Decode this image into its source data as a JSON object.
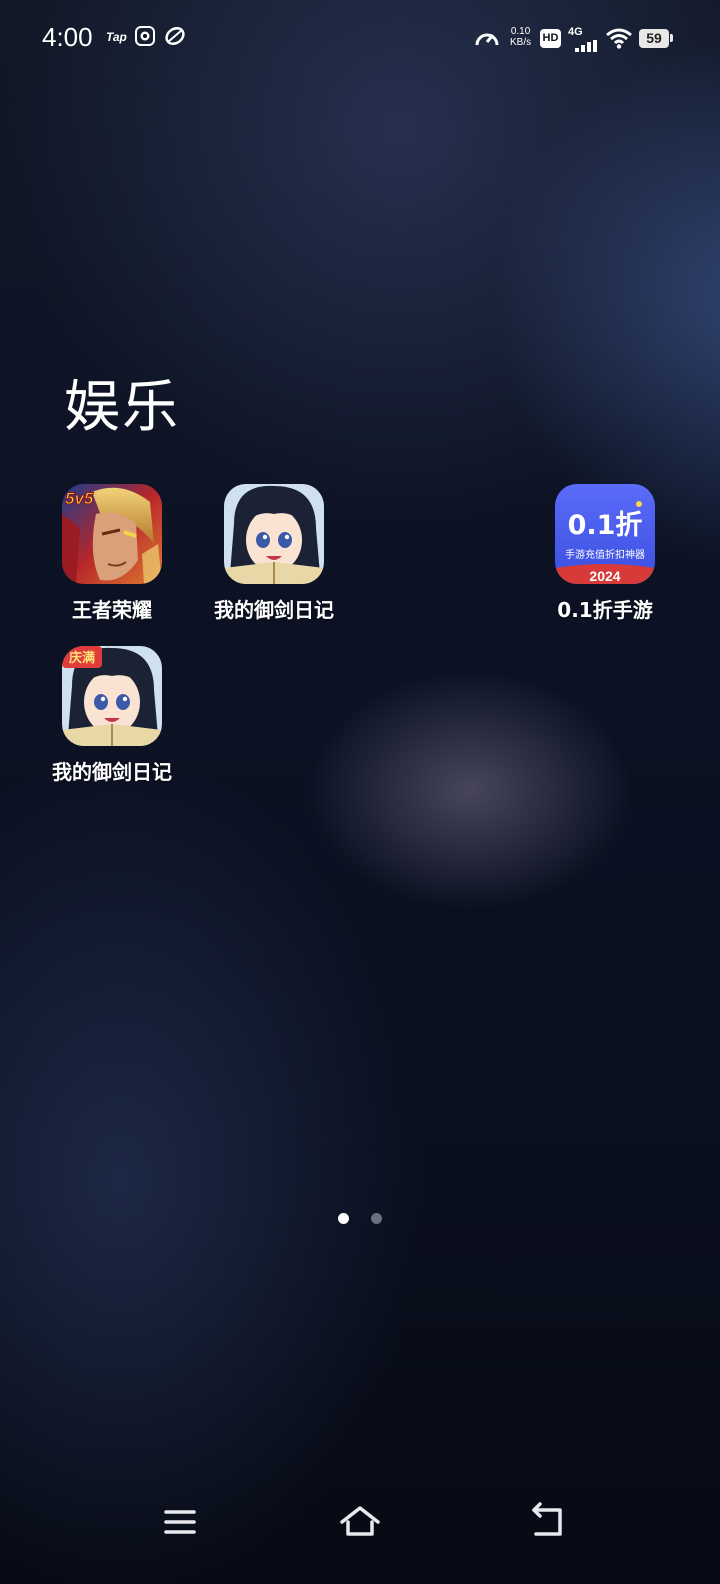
{
  "status_bar": {
    "time": "4:00",
    "left_icons": [
      "tap-icon",
      "cat-app-icon",
      "leaf-icon"
    ],
    "tap_label": "Tap",
    "net_speed_value": "0.10",
    "net_speed_unit": "KB/s",
    "hd_label": "HD",
    "network_label": "4G",
    "battery_level": "59"
  },
  "folder": {
    "title": "娱乐",
    "apps": [
      {
        "label": "王者荣耀",
        "icon": "honor-of-kings-icon",
        "badge": "5v5"
      },
      {
        "label": "我的御剑日记",
        "icon": "sword-diary-icon"
      },
      {
        "label": "0.1折手游",
        "icon": "discount-games-icon",
        "icon_title": "0.1折",
        "icon_subtitle": "手游充值折扣神器",
        "icon_year": "2024"
      },
      {
        "label": "我的御剑日记",
        "icon": "sword-diary-alt-icon",
        "badge": "庆满"
      }
    ]
  },
  "pagination": {
    "pages": 2,
    "current": 1
  },
  "nav_bar": {
    "buttons": [
      "menu-icon",
      "home-icon",
      "back-icon"
    ]
  },
  "colors": {
    "discount_blue": "#4a5cf0",
    "dot_active": "#ffffff",
    "dot_inactive": "#6b7080"
  }
}
